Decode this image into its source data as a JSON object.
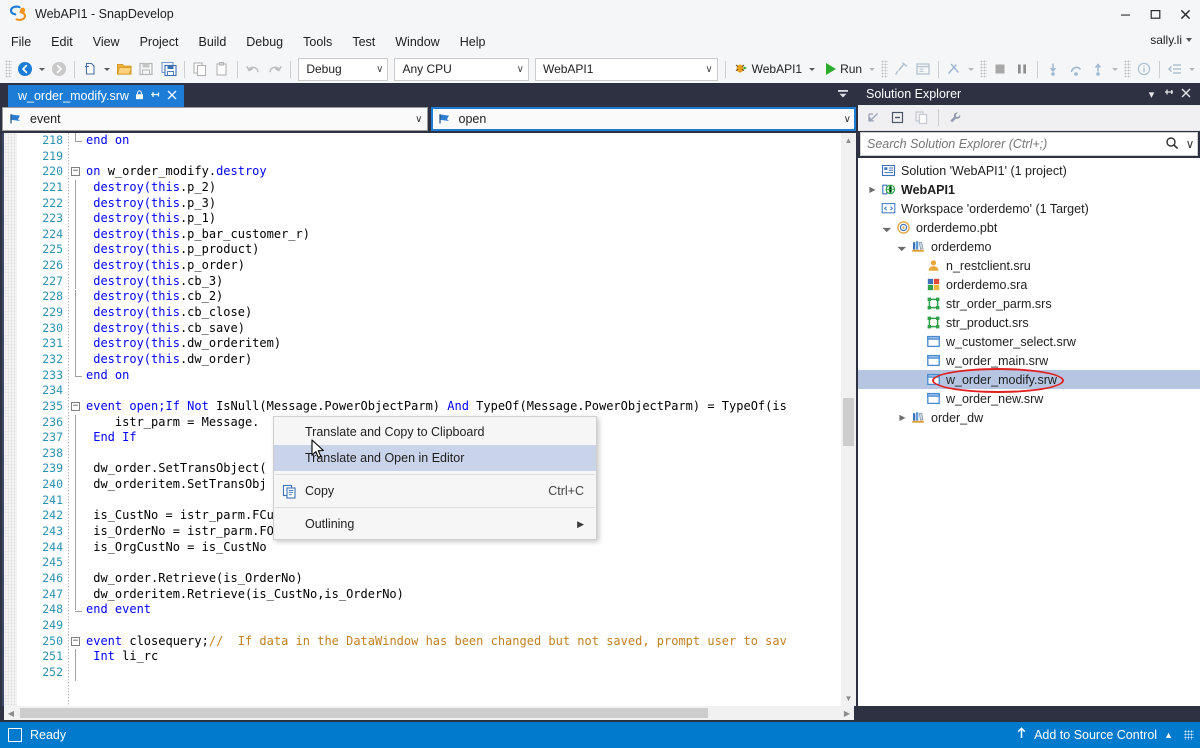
{
  "window": {
    "title": "WebAPI1 - SnapDevelop",
    "logo_icon": "snapdevelop-logo-icon",
    "minimize": "–",
    "maximize": "❐",
    "close": "✕"
  },
  "menubar": {
    "items": [
      "File",
      "Edit",
      "View",
      "Project",
      "Build",
      "Debug",
      "Tools",
      "Test",
      "Window",
      "Help"
    ],
    "user": "sally.li"
  },
  "toolbar": {
    "back_icon": "navigate-back-icon",
    "forward_icon": "navigate-forward-icon",
    "new_icon": "new-item-icon",
    "open_icon": "open-folder-icon",
    "save_icon": "save-icon",
    "save_all_icon": "save-all-icon",
    "copy_icon": "copy-icon",
    "paste_icon": "paste-icon",
    "undo_icon": "undo-icon",
    "redo_icon": "redo-icon",
    "config_value": "Debug",
    "platform_value": "Any CPU",
    "project_value": "WebAPI1",
    "startup_value": "WebAPI1",
    "startup_icon": "debug-bug-icon",
    "run_label": "Run",
    "hammer_icon": "build-hammer-icon",
    "window_icon": "show-window-icon",
    "attach_icon": "attach-process-icon",
    "stop_icon": "stop-icon",
    "pause_icon": "pause-icon",
    "stepinto_icon": "step-into-icon",
    "stepover_icon": "step-over-icon",
    "stepout_icon": "step-out-icon",
    "info_icon": "info-circle-icon",
    "indent_icon": "decrease-indent-icon",
    "chevron": "∨"
  },
  "editor": {
    "tab": {
      "label": "w_order_modify.srw",
      "lock_icon": "lock-icon",
      "pin_icon": "pin-icon",
      "close_icon": "close-icon"
    },
    "tab_overflow_icon": "tab-overflow-icon",
    "nav_left": {
      "value": "event",
      "icon": "event-flag-icon"
    },
    "nav_right": {
      "value": "open",
      "icon": "event-flag-icon"
    },
    "first_line_number": 218,
    "lines": [
      {
        "n": 218,
        "fold": "end",
        "tokens": [
          {
            "t": "end on",
            "c": "kw"
          }
        ],
        "indent": 1
      },
      {
        "n": 219,
        "tokens": []
      },
      {
        "n": 220,
        "fold": "start",
        "tokens": [
          {
            "t": "on ",
            "c": "kw"
          },
          {
            "t": "w_order_modify.",
            "c": "id"
          },
          {
            "t": "destroy",
            "c": "kw"
          }
        ]
      },
      {
        "n": 221,
        "bar": true,
        "tokens": [
          {
            "t": " destroy(",
            "c": "kw"
          },
          {
            "t": "this",
            "c": "kw"
          },
          {
            "t": ".p_2)",
            "c": "id"
          }
        ]
      },
      {
        "n": 222,
        "bar": true,
        "tokens": [
          {
            "t": " destroy(",
            "c": "kw"
          },
          {
            "t": "this",
            "c": "kw"
          },
          {
            "t": ".p_3)",
            "c": "id"
          }
        ]
      },
      {
        "n": 223,
        "bar": true,
        "tokens": [
          {
            "t": " destroy(",
            "c": "kw"
          },
          {
            "t": "this",
            "c": "kw"
          },
          {
            "t": ".p_1)",
            "c": "id"
          }
        ]
      },
      {
        "n": 224,
        "bar": true,
        "tokens": [
          {
            "t": " destroy(",
            "c": "kw"
          },
          {
            "t": "this",
            "c": "kw"
          },
          {
            "t": ".p_bar_customer_r)",
            "c": "id"
          }
        ]
      },
      {
        "n": 225,
        "bar": true,
        "tokens": [
          {
            "t": " destroy(",
            "c": "kw"
          },
          {
            "t": "this",
            "c": "kw"
          },
          {
            "t": ".p_product)",
            "c": "id"
          }
        ]
      },
      {
        "n": 226,
        "bar": true,
        "tokens": [
          {
            "t": " destroy(",
            "c": "kw"
          },
          {
            "t": "this",
            "c": "kw"
          },
          {
            "t": ".p_order)",
            "c": "id"
          }
        ]
      },
      {
        "n": 227,
        "bar": true,
        "tokens": [
          {
            "t": " destroy(",
            "c": "kw"
          },
          {
            "t": "this",
            "c": "kw"
          },
          {
            "t": ".cb_3)",
            "c": "id"
          }
        ]
      },
      {
        "n": 228,
        "bar": true,
        "tokens": [
          {
            "t": " destroy(",
            "c": "kw"
          },
          {
            "t": "this",
            "c": "kw"
          },
          {
            "t": ".cb_2)",
            "c": "id"
          }
        ]
      },
      {
        "n": 229,
        "bar": true,
        "tokens": [
          {
            "t": " destroy(",
            "c": "kw"
          },
          {
            "t": "this",
            "c": "kw"
          },
          {
            "t": ".cb_close)",
            "c": "id"
          }
        ]
      },
      {
        "n": 230,
        "bar": true,
        "tokens": [
          {
            "t": " destroy(",
            "c": "kw"
          },
          {
            "t": "this",
            "c": "kw"
          },
          {
            "t": ".cb_save)",
            "c": "id"
          }
        ]
      },
      {
        "n": 231,
        "bar": true,
        "tokens": [
          {
            "t": " destroy(",
            "c": "kw"
          },
          {
            "t": "this",
            "c": "kw"
          },
          {
            "t": ".dw_orderitem)",
            "c": "id"
          }
        ]
      },
      {
        "n": 232,
        "bar": true,
        "tokens": [
          {
            "t": " destroy(",
            "c": "kw"
          },
          {
            "t": "this",
            "c": "kw"
          },
          {
            "t": ".dw_order)",
            "c": "id"
          }
        ]
      },
      {
        "n": 233,
        "fold": "end",
        "tokens": [
          {
            "t": "end on",
            "c": "kw"
          }
        ]
      },
      {
        "n": 234,
        "tokens": []
      },
      {
        "n": 235,
        "fold": "start",
        "tokens": [
          {
            "t": "event open;",
            "c": "kw"
          },
          {
            "t": "If Not ",
            "c": "kw"
          },
          {
            "t": "IsNull(Message.PowerObjectParm) ",
            "c": "id"
          },
          {
            "t": "And ",
            "c": "kw"
          },
          {
            "t": "TypeOf(Message.PowerObjectParm) = TypeOf(is",
            "c": "id"
          }
        ]
      },
      {
        "n": 236,
        "bar": true,
        "tokens": [
          {
            "t": "    istr_parm = Message.",
            "c": "id"
          }
        ]
      },
      {
        "n": 237,
        "bar": true,
        "tokens": [
          {
            "t": " End If",
            "c": "kw"
          }
        ]
      },
      {
        "n": 238,
        "bar": true,
        "tokens": []
      },
      {
        "n": 239,
        "bar": true,
        "tokens": [
          {
            "t": " dw_order.SetTransObject(",
            "c": "id"
          }
        ]
      },
      {
        "n": 240,
        "bar": true,
        "tokens": [
          {
            "t": " dw_orderitem.SetTransObj",
            "c": "id"
          }
        ]
      },
      {
        "n": 241,
        "bar": true,
        "tokens": []
      },
      {
        "n": 242,
        "bar": true,
        "tokens": [
          {
            "t": " is_CustNo = istr_parm.FCustNo",
            "c": "id"
          }
        ]
      },
      {
        "n": 243,
        "bar": true,
        "tokens": [
          {
            "t": " is_OrderNo = istr_parm.FOrderNo",
            "c": "id"
          }
        ]
      },
      {
        "n": 244,
        "bar": true,
        "tokens": [
          {
            "t": " is_OrgCustNo = is_CustNo",
            "c": "id"
          }
        ]
      },
      {
        "n": 245,
        "bar": true,
        "tokens": []
      },
      {
        "n": 246,
        "bar": true,
        "tokens": [
          {
            "t": " dw_order.Retrieve(is_OrderNo)",
            "c": "id"
          }
        ]
      },
      {
        "n": 247,
        "bar": true,
        "tokens": [
          {
            "t": " dw_orderitem.Retrieve(is_CustNo,is_OrderNo)",
            "c": "id"
          }
        ]
      },
      {
        "n": 248,
        "fold": "end",
        "tokens": [
          {
            "t": "end event",
            "c": "kw"
          }
        ]
      },
      {
        "n": 249,
        "tokens": []
      },
      {
        "n": 250,
        "fold": "start",
        "tokens": [
          {
            "t": "event ",
            "c": "kw"
          },
          {
            "t": "closequery;",
            "c": "id"
          },
          {
            "t": "//  If data in the DataWindow has been changed but not saved, prompt user to sav",
            "c": "cm"
          }
        ]
      },
      {
        "n": 251,
        "bar": true,
        "tokens": [
          {
            "t": " Int ",
            "c": "kw"
          },
          {
            "t": "li_rc",
            "c": "id"
          }
        ]
      },
      {
        "n": 252,
        "bar": true,
        "tokens": []
      }
    ]
  },
  "context_menu": {
    "items": [
      {
        "label": "Translate and Copy to Clipboard",
        "icon": "",
        "accel": "",
        "selected": false,
        "submenu": false
      },
      {
        "label": "Translate and Open in Editor",
        "icon": "",
        "accel": "",
        "selected": true,
        "submenu": false
      },
      {
        "separator": true
      },
      {
        "label": "Copy",
        "icon": "copy-icon",
        "accel": "Ctrl+C",
        "selected": false,
        "submenu": false
      },
      {
        "separator": true
      },
      {
        "label": "Outlining",
        "icon": "",
        "accel": "",
        "selected": false,
        "submenu": true
      }
    ]
  },
  "solution_explorer": {
    "title": "Solution Explorer",
    "header_icons": [
      "dropdown-icon",
      "pin-icon",
      "close-icon"
    ],
    "toolbar_icons": [
      "collapse-all-icon",
      "show-all-files-icon",
      "refresh-icon",
      "properties-wrench-icon"
    ],
    "search_placeholder": "Search Solution Explorer (Ctrl+;)",
    "search_value": "",
    "search_icon": "search-magnifier-icon",
    "search_chevron": "∨",
    "tree": [
      {
        "label": "Solution 'WebAPI1' (1 project)",
        "indent": 1,
        "twist": "",
        "icon": "solution-icon",
        "bold": false,
        "selected": false
      },
      {
        "label": "WebAPI1",
        "indent": 1,
        "twist": "collapsed",
        "icon": "web-project-icon",
        "bold": true,
        "selected": false
      },
      {
        "label": "Workspace 'orderdemo' (1 Target)",
        "indent": 1,
        "twist": "",
        "icon": "workspace-icon",
        "bold": false,
        "selected": false
      },
      {
        "label": "orderdemo.pbt",
        "indent": 2,
        "twist": "expanded",
        "icon": "target-icon",
        "bold": false,
        "selected": false
      },
      {
        "label": "orderdemo",
        "indent": 3,
        "twist": "expanded",
        "icon": "library-icon",
        "bold": false,
        "selected": false
      },
      {
        "label": "n_restclient.sru",
        "indent": 4,
        "twist": "",
        "icon": "user-object-icon",
        "bold": false,
        "selected": false
      },
      {
        "label": "orderdemo.sra",
        "indent": 4,
        "twist": "",
        "icon": "application-icon",
        "bold": false,
        "selected": false
      },
      {
        "label": "str_order_parm.srs",
        "indent": 4,
        "twist": "",
        "icon": "structure-icon",
        "bold": false,
        "selected": false
      },
      {
        "label": "str_product.srs",
        "indent": 4,
        "twist": "",
        "icon": "structure-icon",
        "bold": false,
        "selected": false
      },
      {
        "label": "w_customer_select.srw",
        "indent": 4,
        "twist": "",
        "icon": "window-icon",
        "bold": false,
        "selected": false
      },
      {
        "label": "w_order_main.srw",
        "indent": 4,
        "twist": "",
        "icon": "window-icon",
        "bold": false,
        "selected": false
      },
      {
        "label": "w_order_modify.srw",
        "indent": 4,
        "twist": "",
        "icon": "window-icon",
        "bold": false,
        "selected": true,
        "annotated": true
      },
      {
        "label": "w_order_new.srw",
        "indent": 4,
        "twist": "",
        "icon": "window-icon",
        "bold": false,
        "selected": false
      },
      {
        "label": "order_dw",
        "indent": 3,
        "twist": "collapsed",
        "icon": "library-icon",
        "bold": false,
        "selected": false
      }
    ]
  },
  "statusbar": {
    "status": "Ready",
    "status_icon": "stop-square-icon",
    "source_control": "Add to Source Control",
    "source_control_icon": "upload-arrow-icon",
    "source_control_caret": "▲"
  },
  "colors": {
    "accent": "#007acc",
    "chrome_dark": "#2d3142",
    "tab_active": "#1c7cd6",
    "annotation_red": "#e02020",
    "keyword_blue": "#0000ff",
    "linenum_teal": "#2b91af",
    "comment_orange": "#c08020",
    "selection_blue": "#b6c6e2"
  }
}
